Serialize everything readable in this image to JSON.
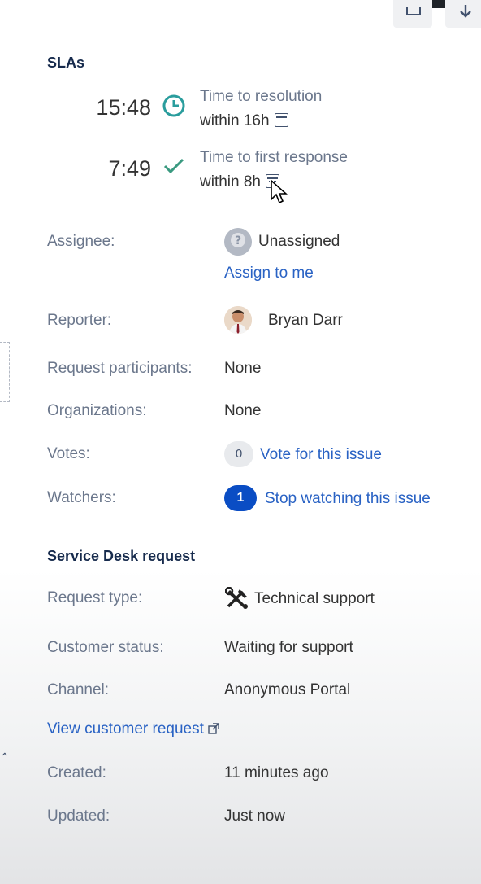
{
  "sla": {
    "title": "SLAs",
    "items": [
      {
        "time": "15:48",
        "icon": "clock-icon",
        "name": "Time to resolution",
        "goal": "within 16h"
      },
      {
        "time": "7:49",
        "icon": "checkmark-icon",
        "name": "Time to first response",
        "goal": "within 8h"
      }
    ]
  },
  "people": {
    "assignee_label": "Assignee:",
    "assignee_value": "Unassigned",
    "assign_to_me": "Assign to me",
    "reporter_label": "Reporter:",
    "reporter_value": "Bryan Darr",
    "participants_label": "Request participants:",
    "participants_value": "None",
    "organizations_label": "Organizations:",
    "organizations_value": "None",
    "votes_label": "Votes:",
    "votes_count": "0",
    "vote_link": "Vote for this issue",
    "watchers_label": "Watchers:",
    "watchers_count": "1",
    "watch_link": "Stop watching this issue"
  },
  "service_desk": {
    "title": "Service Desk request",
    "request_type_label": "Request type:",
    "request_type_value": "Technical support",
    "customer_status_label": "Customer status:",
    "customer_status_value": "Waiting for support",
    "channel_label": "Channel:",
    "channel_value": "Anonymous Portal",
    "view_link": "View customer request"
  },
  "dates": {
    "created_label": "Created:",
    "created_value": "11 minutes ago",
    "updated_label": "Updated:",
    "updated_value": "Just now"
  },
  "colors": {
    "link": "#2962c4",
    "sla_clock": "#2a9d9d",
    "sla_check": "#3a9a80",
    "watch_badge": "#0a4dc4"
  }
}
